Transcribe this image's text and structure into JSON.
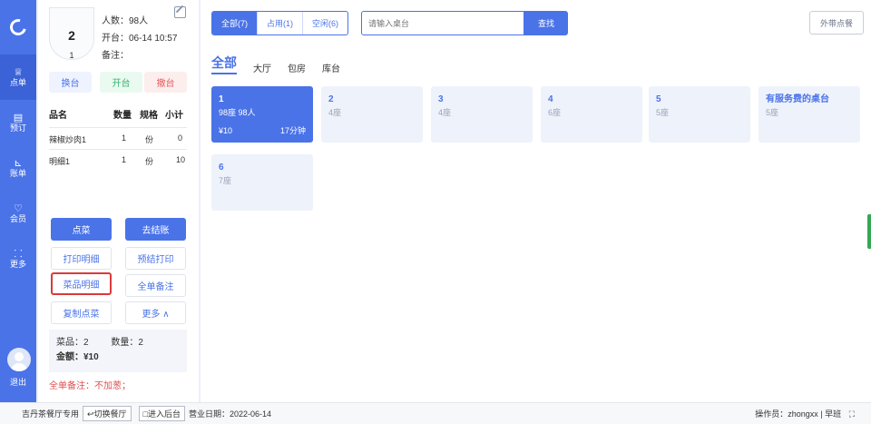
{
  "rail": {
    "items": [
      {
        "label": "点单",
        "icon": "bell-icon",
        "glyph": "♕"
      },
      {
        "label": "预订",
        "icon": "book-icon",
        "glyph": "▤"
      },
      {
        "label": "账单",
        "icon": "chart-icon",
        "glyph": "⊾"
      },
      {
        "label": "会员",
        "icon": "heart-icon",
        "glyph": "♡"
      },
      {
        "label": "更多",
        "icon": "grid-icon",
        "glyph": "⸬"
      }
    ],
    "logout": "退出"
  },
  "order": {
    "table_no": "2",
    "table_sub": "1",
    "guests": "人数：98人",
    "opened": "开台：06-14 10:57",
    "remark": "备注：",
    "buttons": {
      "swap": "换台",
      "open": "开台",
      "clear": "撤台"
    },
    "columns": [
      "品名",
      "数量",
      "规格",
      "小计"
    ],
    "items": [
      {
        "name": "辣椒炒肉1",
        "qty": "1",
        "unit": "份",
        "subtotal": "0"
      },
      {
        "name": "明细1",
        "qty": "1",
        "unit": "份",
        "subtotal": "10"
      }
    ],
    "actions": {
      "order": "点菜",
      "checkout": "去结账",
      "print_detail": "打印明细",
      "pre_print": "预结打印",
      "dish_detail": "菜品明细",
      "whole_note": "全单备注",
      "copy_order": "复制点菜",
      "more": "更多 ∧"
    },
    "summary": {
      "dishes": "菜品：2",
      "qty": "数量：2",
      "amount": "金额：¥10"
    },
    "note": "全单备注：不加葱；"
  },
  "main": {
    "filters": [
      {
        "label": "全部(7)",
        "selected": true
      },
      {
        "label": "占用(1)",
        "selected": false
      },
      {
        "label": "空闲(6)",
        "selected": false
      }
    ],
    "search_placeholder": "请输入桌台",
    "search_button": "查找",
    "takeaway": "外带点餐",
    "areas": [
      "全部",
      "大厅",
      "包房",
      "库台"
    ],
    "tables": [
      {
        "num": "1",
        "seats": "98座",
        "guests": "98人",
        "amount": "¥10",
        "time": "17分钟",
        "busy": true
      },
      {
        "num": "2",
        "seats": "4座",
        "busy": false
      },
      {
        "num": "3",
        "seats": "4座",
        "busy": false
      },
      {
        "num": "4",
        "seats": "6座",
        "busy": false
      },
      {
        "num": "5",
        "seats": "5座",
        "busy": false
      },
      {
        "num": "有服务费的桌台",
        "seats": "5座",
        "busy": false
      },
      {
        "num": "6",
        "seats": "7座",
        "busy": false
      }
    ]
  },
  "status": {
    "restaurant": "吉丹茶餐厅专用",
    "switch_store": "↩切换餐厅",
    "backend": "□进入后台",
    "business_date": "营业日期：2022-06-14",
    "operator": "操作员：zhongxx",
    "shift": "早班"
  },
  "colors": {
    "accent": "#4a73e8",
    "danger": "#e05050",
    "success": "#34b36b"
  }
}
